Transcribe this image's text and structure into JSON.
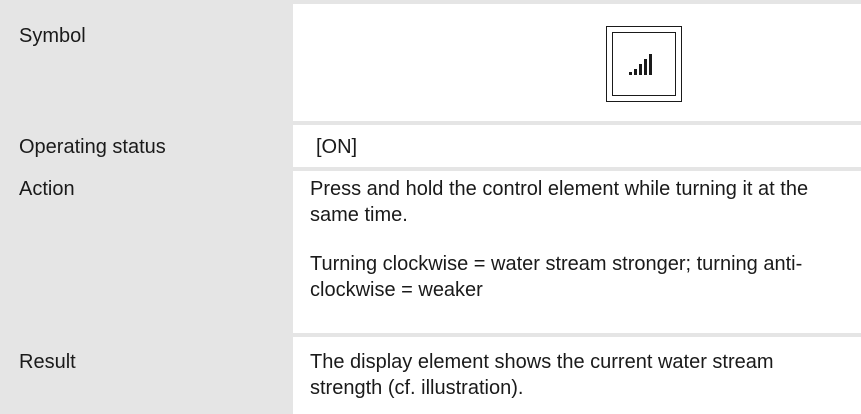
{
  "rows": [
    {
      "label": "Symbol",
      "icon": "signal-strength-icon"
    },
    {
      "label": "Operating status",
      "value": "[ON]"
    },
    {
      "label": "Action",
      "paragraphs": [
        "Press and hold the control element while turning it at the same time.",
        "Turning clockwise = water stream stronger; turning anti-clockwise = weaker"
      ]
    },
    {
      "label": "Result",
      "paragraphs": [
        "The display element shows the current water stream strength (cf. illustration)."
      ]
    }
  ],
  "colors": {
    "label_background": "#e5e5e5",
    "text": "#1a1a1a"
  }
}
